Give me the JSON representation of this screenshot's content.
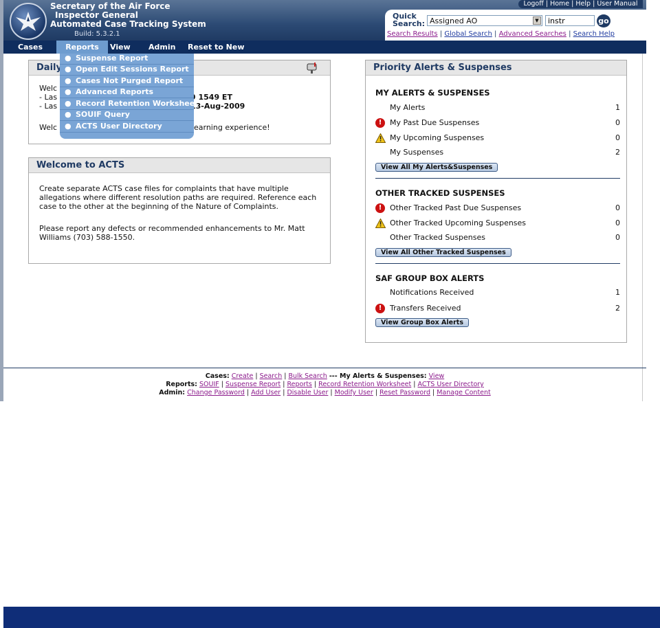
{
  "header": {
    "title_lines": [
      "Secretary of the Air Force",
      "Inspector General",
      "Automated Case Tracking System"
    ],
    "build": "Build: 5.3.2.1",
    "top_links": [
      "Logoff",
      "Home",
      "Help",
      "User Manual"
    ]
  },
  "quick_search": {
    "label_line1": "Quick",
    "label_line2": "Search:",
    "selected_field": "Assigned AO",
    "input_value": "instr",
    "go_label": "go",
    "links": [
      "Search Results",
      "Global Search",
      "Advanced Searches",
      "Search Help"
    ]
  },
  "nav": {
    "items": [
      "Cases",
      "Reports",
      "View",
      "Admin",
      "Reset to New"
    ],
    "active": "Reports"
  },
  "reports_menu": {
    "items": [
      "Suspense Report",
      "Open Edit Sessions Report",
      "Cases Not Purged Report",
      "Advanced Reports",
      "Record Retention Worksheet",
      "SOUIF Query",
      "ACTS User Directory"
    ]
  },
  "daily_box": {
    "title_visible": "Daily",
    "line1_visible": "Welc",
    "line2_left": "- Las",
    "line2_right": "9 1549 ET",
    "line3_left": "- Las",
    "line3_right": "13-Aug-2009",
    "line4_left": "Welc",
    "line4_right": "earning experience!"
  },
  "welcome_box": {
    "title": "Welcome to ACTS",
    "para1": "Create separate ACTS case files for complaints that have multiple allegations where different resolution paths are required. Reference each case to the other at the beginning of the Nature of Complaints.",
    "para2": "Please report any defects or recommended enhancements to Mr. Matt Williams (703) 588-1550."
  },
  "priority": {
    "title": "Priority Alerts & Suspenses",
    "sections": [
      {
        "heading": "MY ALERTS & SUSPENSES",
        "rows": [
          {
            "label": "My Alerts",
            "count": "1",
            "icon": "none"
          },
          {
            "label": "My Past Due Suspenses",
            "count": "0",
            "icon": "error-icon"
          },
          {
            "label": "My Upcoming Suspenses",
            "count": "0",
            "icon": "warning-icon"
          },
          {
            "label": "My Suspenses",
            "count": "2",
            "icon": "none"
          }
        ],
        "button": "View All My Alerts&Suspenses"
      },
      {
        "heading": "OTHER TRACKED SUSPENSES",
        "rows": [
          {
            "label": "Other Tracked Past Due Suspenses",
            "count": "0",
            "icon": "error-icon"
          },
          {
            "label": "Other Tracked Upcoming Suspenses",
            "count": "0",
            "icon": "warning-icon"
          },
          {
            "label": "Other Tracked Suspenses",
            "count": "0",
            "icon": "none"
          }
        ],
        "button": "View All Other Tracked Suspenses"
      },
      {
        "heading": "SAF GROUP BOX ALERTS",
        "rows": [
          {
            "label": "Notifications Received",
            "count": "1",
            "icon": "none"
          },
          {
            "label": "Transfers Received",
            "count": "2",
            "icon": "error-icon"
          }
        ],
        "button": "View Group Box Alerts"
      }
    ]
  },
  "footer": {
    "cases_label": "Cases:",
    "cases_links": [
      "Create",
      "Search",
      "Bulk Search"
    ],
    "alerts_label": "--- My Alerts & Suspenses:",
    "alerts_link": "View",
    "reports_label": "Reports:",
    "reports_links": [
      "SOUIF",
      "Suspense Report",
      "Reports",
      "Record Retention Worksheet",
      "ACTS User Directory"
    ],
    "admin_label": "Admin:",
    "admin_links": [
      "Change Password",
      "Add User",
      "Disable User",
      "Modify User",
      "Reset Password",
      "Manage Content"
    ]
  },
  "colors": {
    "nav_bg": "#0f2d5e",
    "menu_bg": "#7aa5d6",
    "box_title": "#1f3a63",
    "link_visited": "#8b1a8b",
    "error": "#cc1111",
    "warning": "#f0c419"
  }
}
